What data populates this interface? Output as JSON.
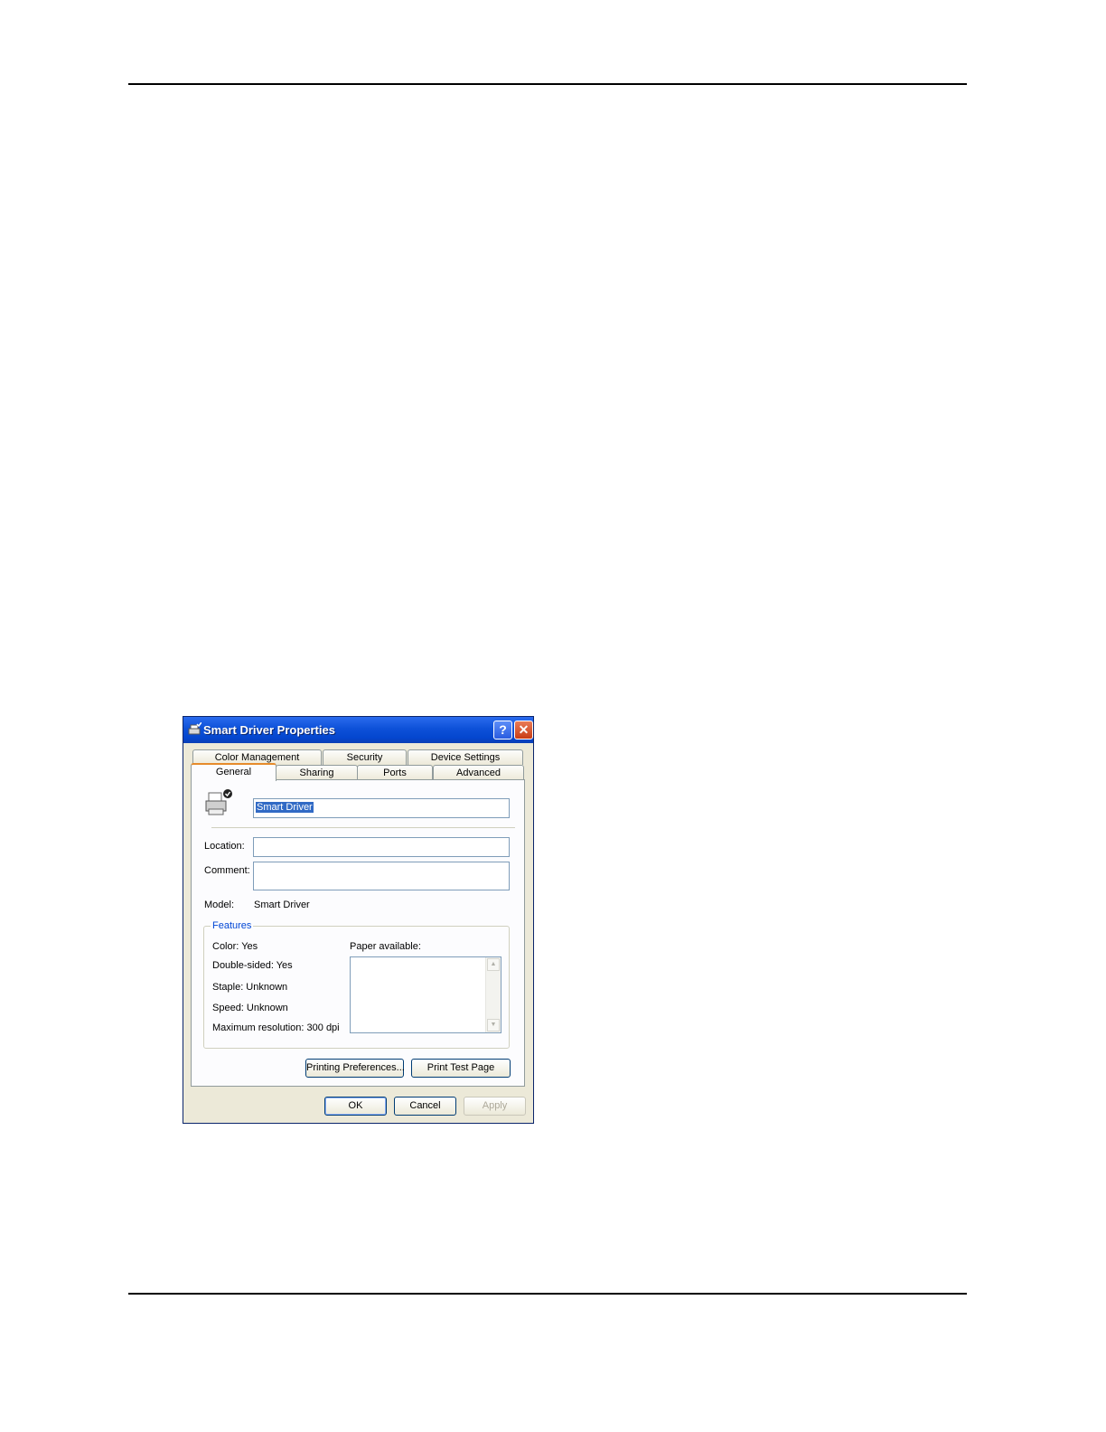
{
  "dialog": {
    "title": "Smart Driver Properties",
    "help_glyph": "?",
    "close_glyph": "✕",
    "tabs_back": [
      "Color Management",
      "Security",
      "Device Settings"
    ],
    "tabs_front": [
      "General",
      "Sharing",
      "Ports",
      "Advanced"
    ],
    "active_tab": "General",
    "printer_name": "Smart Driver",
    "location_label": "Location:",
    "location_value": "",
    "comment_label": "Comment:",
    "comment_value": "",
    "model_label": "Model:",
    "model_value": "Smart Driver",
    "features": {
      "title": "Features",
      "color": "Color: Yes",
      "double_sided": "Double-sided: Yes",
      "staple": "Staple: Unknown",
      "speed": "Speed: Unknown",
      "max_resolution": "Maximum resolution: 300 dpi",
      "paper_label": "Paper available:"
    },
    "buttons": {
      "printing_preferences": "Printing Preferences...",
      "print_test_page": "Print Test Page",
      "ok": "OK",
      "cancel": "Cancel",
      "apply": "Apply"
    }
  }
}
